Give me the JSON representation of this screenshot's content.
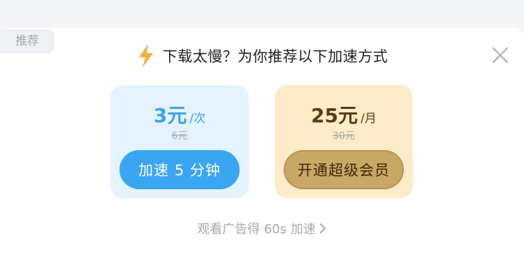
{
  "tag": {
    "label": "推荐"
  },
  "header": {
    "title": "下载太慢？为你推荐以下加速方式"
  },
  "cards": [
    {
      "price": "3元",
      "unit": "/次",
      "original": "6元",
      "button": "加速 5 分钟",
      "accent": "#3aa6f2"
    },
    {
      "price": "25元",
      "unit": "/月",
      "original": "30元",
      "button": "开通超级会员",
      "accent": "#c9a765"
    }
  ],
  "ad": {
    "label": "观看广告得 60s 加速"
  },
  "icons": {
    "header": "lightning-icon",
    "close": "close-icon",
    "ad": "chevron-right-icon"
  }
}
